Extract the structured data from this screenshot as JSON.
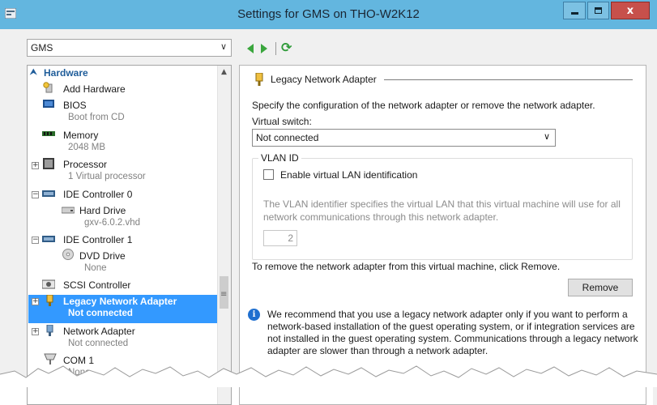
{
  "window": {
    "title": "Settings for GMS on THO-W2K12",
    "close_glyph": "x"
  },
  "vm_selector": {
    "value": "GMS",
    "arrow": "∨"
  },
  "tree": {
    "section_label": "Hardware",
    "items": [
      {
        "label": "Add Hardware",
        "sub": ""
      },
      {
        "label": "BIOS",
        "sub": "Boot from CD"
      },
      {
        "label": "Memory",
        "sub": "2048 MB"
      },
      {
        "label": "Processor",
        "sub": "1 Virtual processor"
      },
      {
        "label": "IDE Controller 0",
        "sub": ""
      },
      {
        "label": "Hard Drive",
        "sub": "gxv-6.0.2.vhd"
      },
      {
        "label": "IDE Controller 1",
        "sub": ""
      },
      {
        "label": "DVD Drive",
        "sub": "None"
      },
      {
        "label": "SCSI Controller",
        "sub": ""
      },
      {
        "label": "Legacy Network Adapter",
        "sub": "Not connected"
      },
      {
        "label": "Network Adapter",
        "sub": "Not connected"
      },
      {
        "label": "COM 1",
        "sub": "None"
      }
    ],
    "expander_plus": "+",
    "expander_minus": "−",
    "scroll_up_glyph": "▲",
    "scroll_grip_glyph": "≡"
  },
  "details": {
    "heading": "Legacy Network Adapter",
    "description": "Specify the configuration of the network adapter or remove the network adapter.",
    "virtual_switch_label": "Virtual switch:",
    "virtual_switch_value": "Not connected",
    "vlan_group_title": "VLAN ID",
    "vlan_checkbox_label": "Enable virtual LAN identification",
    "vlan_checked": false,
    "vlan_description": "The VLAN identifier specifies the virtual LAN that this virtual machine will use for all network communications through this network adapter.",
    "vlan_number": "2",
    "remove_text": "To remove the network adapter from this virtual machine, click Remove.",
    "remove_button": "Remove",
    "info_text": "We recommend that you use a legacy network adapter only if you want to perform a network-based installation of the guest operating system, or if integration services are not installed in the guest operating system. Communications through a legacy network adapter are slower than through a network adapter."
  },
  "colors": {
    "titlebar": "#63b6df",
    "selection": "#3399ff",
    "close_button": "#c7504b",
    "section_heading": "#1f5d9a",
    "nav_arrows": "#3aa63d"
  }
}
